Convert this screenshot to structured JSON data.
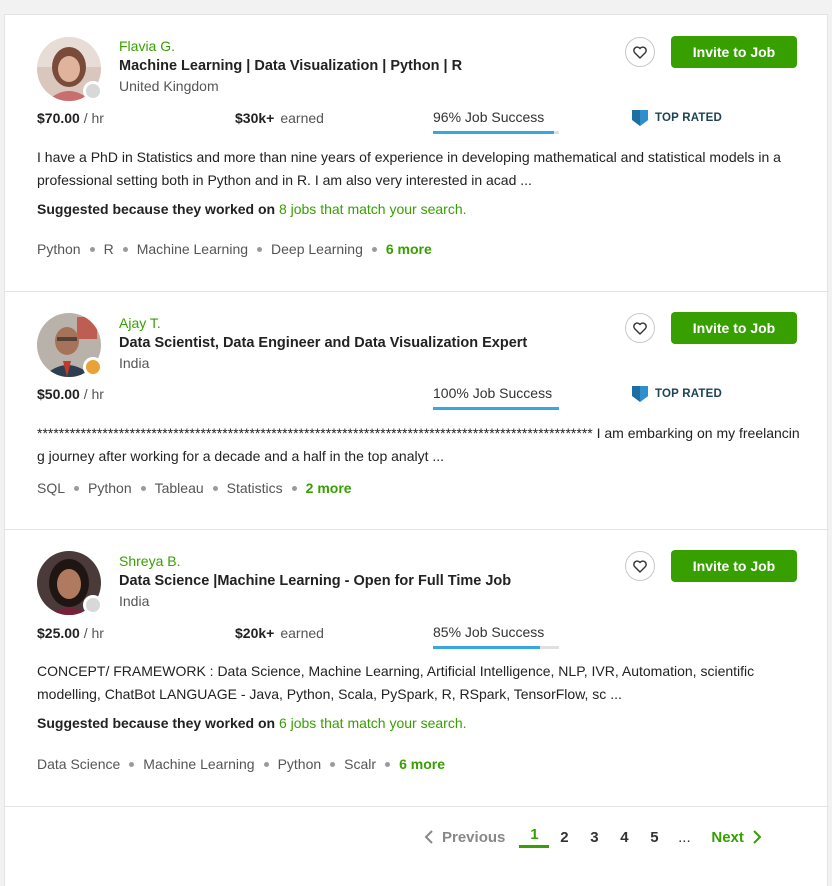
{
  "colors": {
    "accent": "#37a000",
    "jss_bar": "#37a7e0",
    "top_rated": "#1d6fa3"
  },
  "freelancers": [
    {
      "name": "Flavia G.",
      "title": "Machine Learning | Data Visualization | Python | R",
      "country": "United Kingdom",
      "rate": "$70.00",
      "rate_unit": "/ hr",
      "earned": "$30k+",
      "earned_label": "earned",
      "jss": "96% Job Success",
      "jss_fraction": 0.96,
      "badge": "TOP RATED",
      "description": "I have a PhD in Statistics and more than nine years of experience in developing mathematical and statistical models in a professional setting both in Python and in R. I am also very interested in acad ...",
      "suggest_prefix": "Suggested because they worked on",
      "suggest_link": "8 jobs that match your search.",
      "skills": [
        "Python",
        "R",
        "Machine Learning",
        "Deep Learning"
      ],
      "more": "6 more",
      "invite": "Invite to Job",
      "status": "offline"
    },
    {
      "name": "Ajay T.",
      "title": "Data Scientist, Data Engineer and Data Visualization Expert",
      "country": "India",
      "rate": "$50.00",
      "rate_unit": "/ hr",
      "jss": "100% Job Success",
      "jss_fraction": 1.0,
      "badge": "TOP RATED",
      "description": "****************************************************************************************************** I am embarking on my freelancing journey after working for a decade and a half in the top analyt ...",
      "skills": [
        "SQL",
        "Python",
        "Tableau",
        "Statistics"
      ],
      "more": "2 more",
      "invite": "Invite to Job",
      "status": "away"
    },
    {
      "name": "Shreya B.",
      "title": "Data Science |Machine Learning - Open for Full Time Job",
      "country": "India",
      "rate": "$25.00",
      "rate_unit": "/ hr",
      "earned": "$20k+",
      "earned_label": "earned",
      "jss": "85% Job Success",
      "jss_fraction": 0.85,
      "description": "CONCEPT/ FRAMEWORK : Data Science, Machine Learning, Artificial Intelligence, NLP, IVR, Automation, scientific modelling, ChatBot LANGUAGE - Java, Python, Scala, PySpark, R, RSpark, TensorFlow, sc ...",
      "suggest_prefix": "Suggested because they worked on",
      "suggest_link": "6 jobs that match your search.",
      "skills": [
        "Data Science",
        "Machine Learning",
        "Python",
        "Scalr"
      ],
      "more": "6 more",
      "invite": "Invite to Job",
      "status": "offline"
    }
  ],
  "pagination": {
    "previous": "Previous",
    "pages": [
      "1",
      "2",
      "3",
      "4",
      "5"
    ],
    "current": "1",
    "ellipsis": "...",
    "next": "Next"
  },
  "icons": {
    "heart": "heart-icon",
    "badge": "top-rated-badge-icon",
    "prev": "chevron-left-icon",
    "next": "chevron-right-icon"
  }
}
